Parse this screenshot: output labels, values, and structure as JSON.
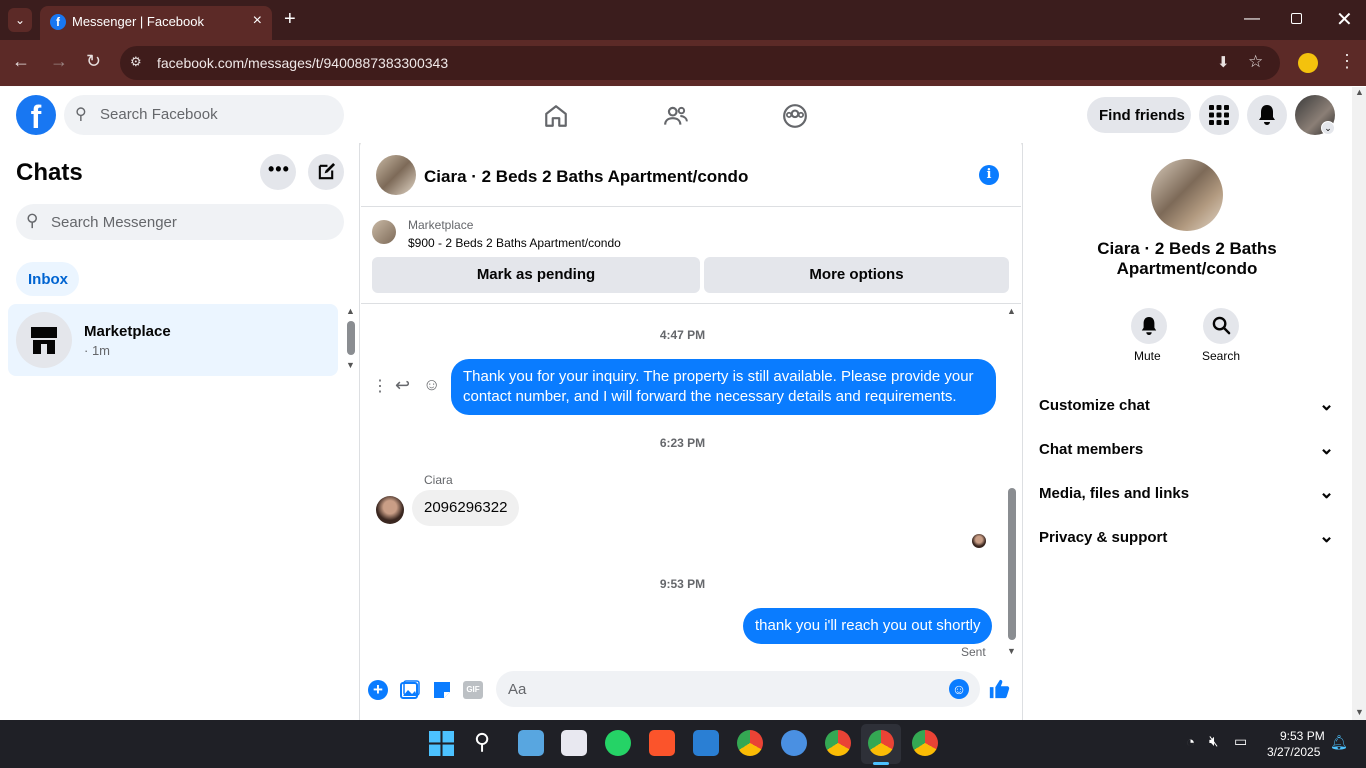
{
  "browser": {
    "tab_title": "Messenger | Facebook",
    "url": "facebook.com/messages/t/9400887383300343"
  },
  "fbnav": {
    "search_placeholder": "Search Facebook",
    "find_friends": "Find friends"
  },
  "chats": {
    "heading": "Chats",
    "search_placeholder": "Search Messenger",
    "filter_label": "Inbox",
    "items": [
      {
        "name": "Marketplace",
        "meta": "· 1m"
      }
    ]
  },
  "conversation": {
    "title": "Ciara · 2 Beds 2 Baths Apartment/condo",
    "listing_source": "Marketplace",
    "listing_title": "$900 - 2 Beds 2 Baths Apartment/condo",
    "mark_pending": "Mark as pending",
    "more_options": "More options",
    "messages": [
      {
        "time": "4:47 PM"
      },
      {
        "from": "me",
        "text": "Thank you for your inquiry. The property is still available. Please provide your contact number, and I will forward the necessary details and requirements."
      },
      {
        "time": "6:23 PM"
      },
      {
        "from": "Ciara",
        "sender_label": "Ciara",
        "text": "2096296322"
      },
      {
        "time": "9:53 PM"
      },
      {
        "from": "me",
        "text": "thank you i'll reach you out shortly",
        "status": "Sent"
      }
    ],
    "composer_placeholder": "Aa"
  },
  "details": {
    "title": "Ciara · 2 Beds 2 Baths Apartment/condo",
    "actions": [
      {
        "label": "Mute"
      },
      {
        "label": "Search"
      }
    ],
    "sections": [
      {
        "label": "Customize chat"
      },
      {
        "label": "Chat members"
      },
      {
        "label": "Media, files and links"
      },
      {
        "label": "Privacy & support"
      }
    ]
  },
  "taskbar": {
    "time": "9:53 PM",
    "date": "3/27/2025"
  },
  "colors": {
    "fb_blue": "#1877f2",
    "bubble_blue": "#0a7cff",
    "chrome_dark": "#3b1d1d",
    "chrome_toolbar": "#5c2a27"
  }
}
